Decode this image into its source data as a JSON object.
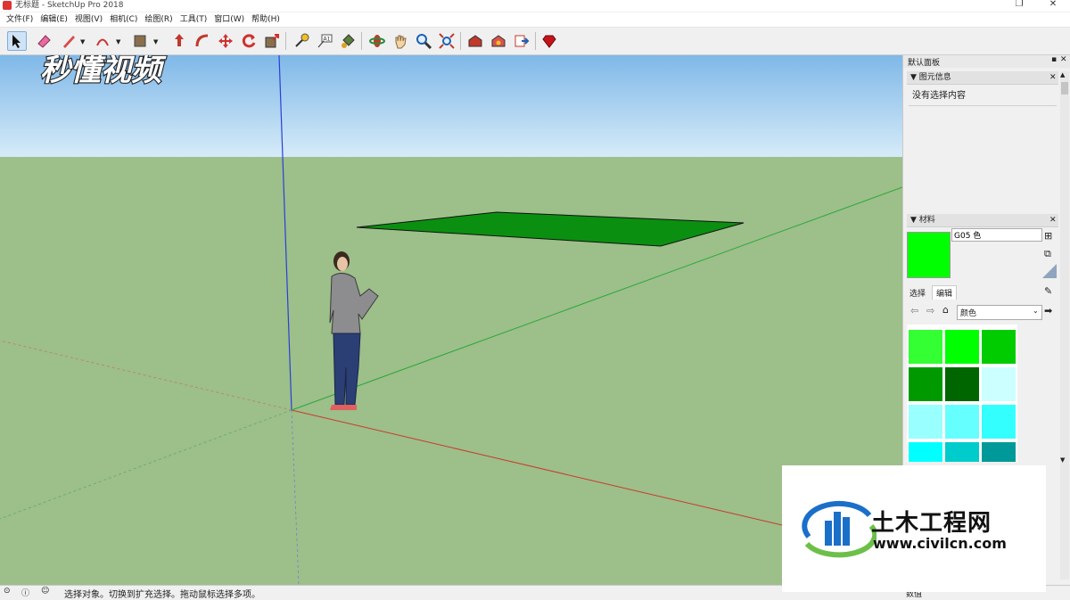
{
  "window": {
    "title": "无标题 - SketchUp Pro 2018",
    "restore_glyph": "❐",
    "close_glyph": "✕"
  },
  "menu": [
    "文件(F)",
    "编辑(E)",
    "视图(V)",
    "相机(C)",
    "绘图(R)",
    "工具(T)",
    "窗口(W)",
    "帮助(H)"
  ],
  "watermark": {
    "text": "秒懂视频"
  },
  "panel": {
    "tray_title": "默认面板",
    "entity_info": {
      "title": "图元信息",
      "status": "没有选择内容"
    },
    "materials": {
      "title": "材料",
      "name_value": "G05 色",
      "current_color": "#00ff00",
      "tabs": [
        "选择",
        "编辑"
      ],
      "library_value": "颜色",
      "swatches": [
        "#33ff33",
        "#00ff00",
        "#00cc00",
        "#009900",
        "#006600",
        "#ccffff",
        "#99ffff",
        "#66ffff",
        "#33ffff",
        "#00ffff",
        "#00cccc",
        "#009999"
      ]
    }
  },
  "statusbar": {
    "message": "选择对象。切换到扩充选择。拖动鼠标选择多项。",
    "measurements_label": "数值"
  },
  "badge": {
    "brand": "土木工程网",
    "url": "www.civilcn.com"
  },
  "colors": {
    "sky_top": "#7fb8e8",
    "ground": "#9dbf8a",
    "rectangle_face": "#0b8f10"
  }
}
